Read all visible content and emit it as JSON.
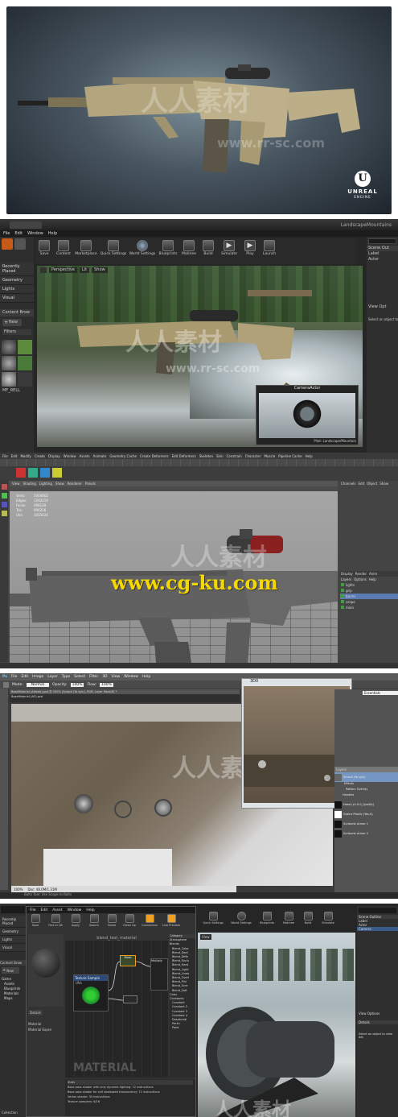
{
  "hero": {
    "logo_line1": "UNREAL",
    "logo_line2": "ENGINE"
  },
  "watermark": {
    "cn": "人人素材",
    "url": "www.rr-sc.com",
    "url2": "www.cg-ku.com"
  },
  "ue4": {
    "title": "LandscapeMountains",
    "menu": [
      "File",
      "Edit",
      "Window",
      "Help"
    ],
    "toolbar": [
      "Save",
      "Content",
      "Marketplace",
      "Quick Settings",
      "World Settings",
      "Blueprints",
      "Matinee",
      "Build",
      "Simulate",
      "Play",
      "Launch"
    ],
    "modes": [
      "Recently Placed",
      "Geometry",
      "Lights",
      "Visual"
    ],
    "viewport_label": "Perspective",
    "lit": "Lit",
    "show": "Show",
    "content_browser": "Content Brow",
    "new_btn": "New",
    "filters": "Filters",
    "asset_name": "MF_RELL",
    "right_panel": [
      "Scene Out",
      "Label",
      "Actor"
    ],
    "details_hint": "Select an object to",
    "view_opt": "View Opt",
    "camera_actor": "CameraActor",
    "camera_sub": "Pilot: Landscape/Mountain"
  },
  "maya": {
    "menu": [
      "File",
      "Edit",
      "Modify",
      "Create",
      "Display",
      "Window",
      "Assets",
      "Animate",
      "Geometry Cache",
      "Create Deformers",
      "Edit Deformers",
      "Skeleton",
      "Skin",
      "Constrain",
      "Character",
      "Muscle",
      "Pipeline Cache",
      "Help"
    ],
    "panel_menu": [
      "View",
      "Shading",
      "Lighting",
      "Show",
      "Renderer",
      "Panels"
    ],
    "stats": [
      {
        "k": "Verts:",
        "v": "1004862"
      },
      {
        "k": "Edges:",
        "v": "1502419"
      },
      {
        "k": "Faces:",
        "v": "498128"
      },
      {
        "k": "Tris:",
        "v": "996256"
      },
      {
        "k": "UVs:",
        "v": "1055424"
      }
    ],
    "right_tabs": [
      "Channels",
      "Edit",
      "Object",
      "Show"
    ],
    "layer_tabs": [
      "Display",
      "Render",
      "Anim"
    ],
    "layer_menu": [
      "Layers",
      "Options",
      "Help"
    ],
    "layers": [
      "lights",
      "grip",
      "barrel",
      "scope",
      "main"
    ],
    "watermark_big": "www.cg-ku.com"
  },
  "ps": {
    "menu": [
      "File",
      "Edit",
      "Image",
      "Layer",
      "Type",
      "Select",
      "Filter",
      "3D",
      "View",
      "Window",
      "Help"
    ],
    "options": {
      "mode_label": "Mode:",
      "mode": "Normal",
      "opacity_label": "Opacity:",
      "opacity": "100%",
      "flow_label": "Flow:",
      "flow": "100%"
    },
    "doc_tabs": [
      "BaseMaterial (Albedo).psd @ 200% (Smock (Yo sylu), RGB, Layer Mask/8) *",
      "BaseMaterial (AO).psd"
    ],
    "status_zoom": "100%",
    "status_doc": "Doc: 48.0M/1.31M",
    "panel_3d": "3D0",
    "essentials": "Essentials",
    "layers_tab": "Layers",
    "layer_names": [
      "Smock (Yo sylu)",
      "Effects",
      "Pattern Overlay",
      "Handles",
      "Head (v1.0.0_Qualify)",
      "Grains Plastic (Yes.0)",
      "Sunburst Armor 1",
      "Sunburst Armor 2"
    ],
    "status_tool": "Bolts Tool: Use Scope to Bolts"
  },
  "mat": {
    "menu": [
      "File",
      "Edit",
      "Asset",
      "Window",
      "Help"
    ],
    "toolbar": [
      "Save",
      "Find in CB",
      "Apply",
      "Search",
      "Home",
      "Clean Up",
      "Connectors",
      "Live Preview"
    ],
    "graph_title": "blend_test_material",
    "node_tex": "Texture Sample",
    "node_uvs": "UVs",
    "node_multiply": "Multiply",
    "node_mask": "Mask",
    "graph_label": "MATERIAL",
    "details": "Details",
    "details_items": [
      "Material",
      "Material Expre"
    ],
    "stats_title": "Stats",
    "stats_lines": [
      "Base pass shader with only dynamic lighting: 72 instructions",
      "Base pass shader for self shadowed translucency: 71 instructions",
      "Vertex shader: 30 instructions",
      "Texture samplers: 6/16"
    ],
    "palette_label": "Category",
    "palette_groups": [
      "Atmosphere",
      "Blends",
      "Color",
      "Constants"
    ],
    "palette_items": [
      "Blend_Color",
      "Blend_Dark",
      "Blend_Diffe",
      "Blend_Exclu",
      "Blend_Hard",
      "Blend_Light",
      "Blend_Linea",
      "Blend_Overl",
      "Blend_Pinl",
      "Blend_Scre",
      "Blend_Soft",
      "Constant",
      "Constant 2",
      "Constant 3",
      "Constant 4",
      "Desaturati",
      "Perlin",
      "Paint"
    ],
    "left": [
      "Recently Placed",
      "Geometry",
      "Lights",
      "Visual"
    ],
    "content": "Content Brow",
    "new_btn": "New",
    "tree": [
      "Game",
      "Assets",
      "Blueprints",
      "Materials",
      "Maps"
    ],
    "tree_label": "Collection",
    "ue_toolbar": [
      "Quick Settings",
      "World Settings",
      "Blueprints",
      "Matinee",
      "Build",
      "Simulate"
    ],
    "view": "View",
    "right": [
      "Scene Outline",
      "Label",
      "Actor",
      "Camera"
    ],
    "details2": "Details",
    "hint2": "Select an object to view det",
    "view_options": "View Options"
  },
  "colors": {
    "ue_dark": "#2b2b2b",
    "maya_grey": "#a0a0a0",
    "ps_dark": "#3a3a3a",
    "accent_orange": "#f0a020",
    "node_green": "#1a8a2a",
    "maya_green": "#3ca03c"
  }
}
